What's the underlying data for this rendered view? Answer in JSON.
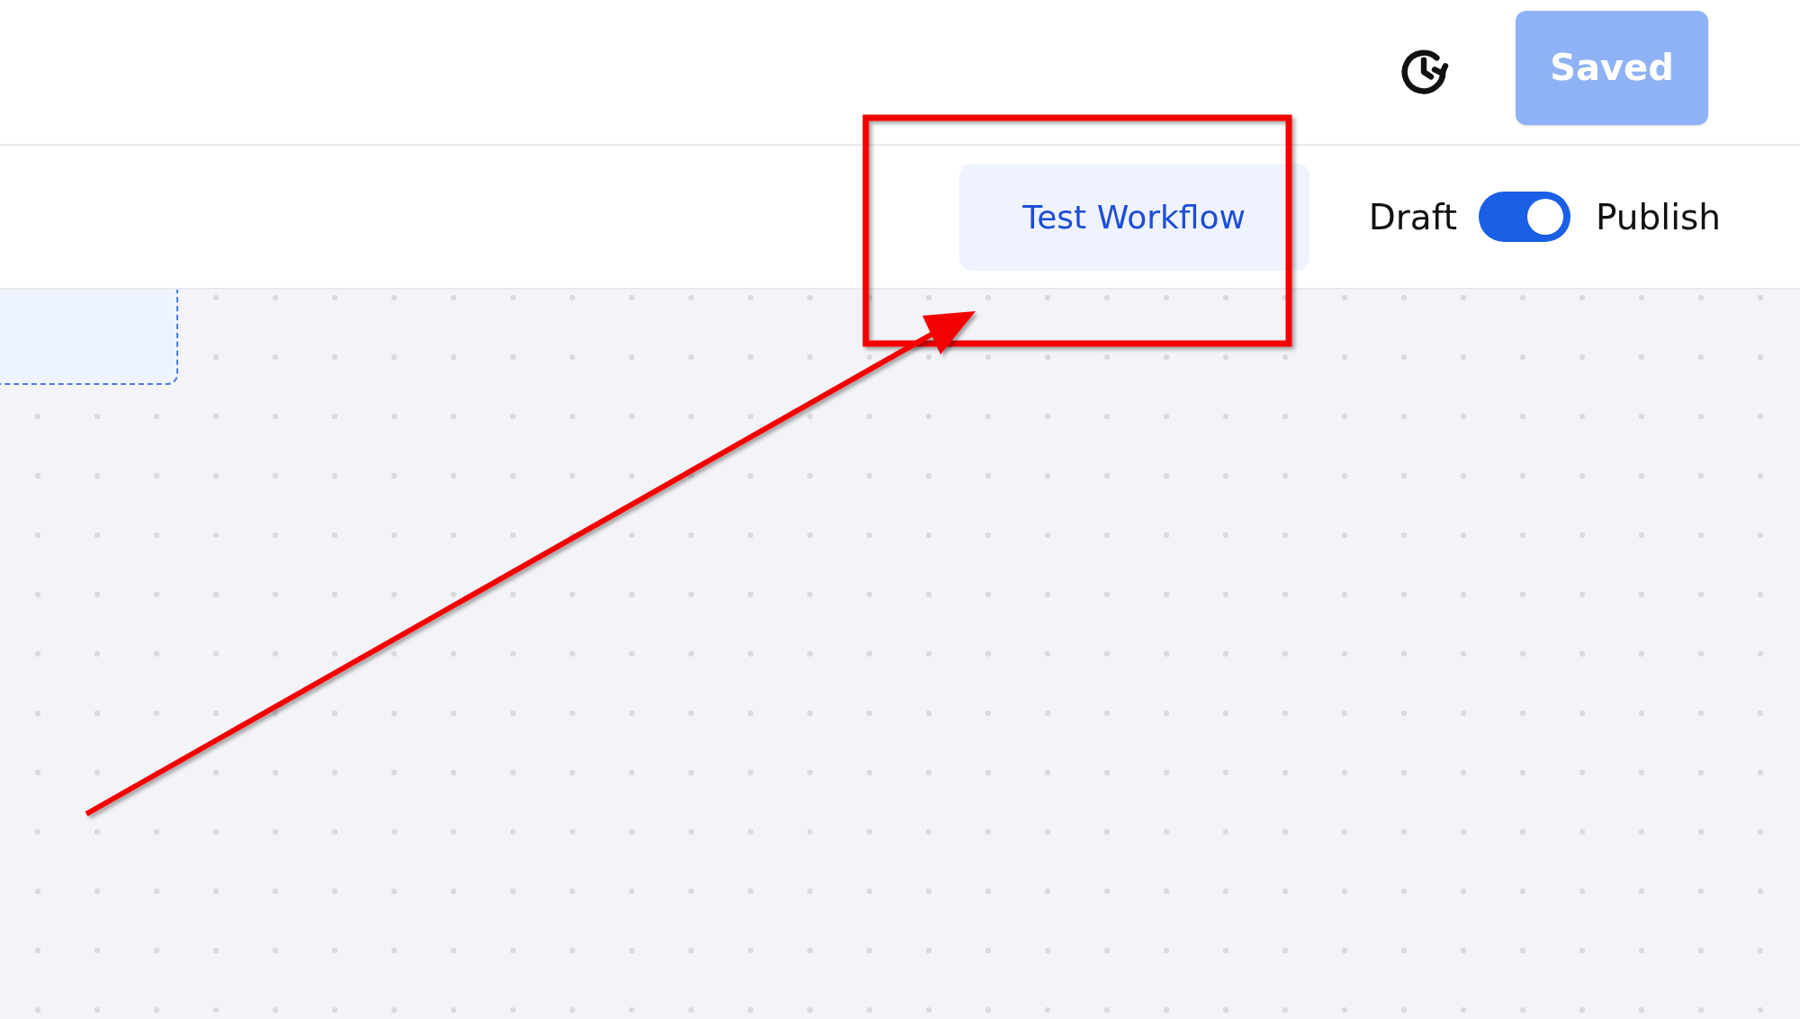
{
  "header": {
    "save_button": {
      "label": "Saved",
      "disabled": true
    }
  },
  "toolbar": {
    "test_button": {
      "label": "Test Workflow"
    },
    "status_toggle": {
      "off_label": "Draft",
      "on_label": "Publish",
      "on": true
    }
  }
}
